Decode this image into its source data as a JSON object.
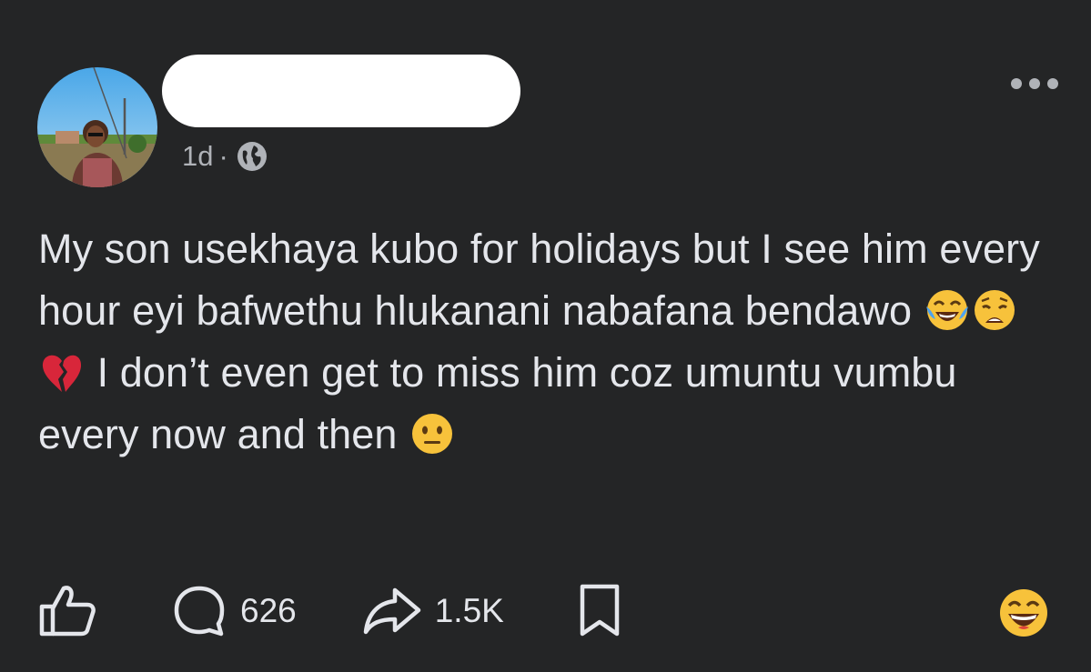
{
  "post": {
    "time": "1d",
    "separator": "·",
    "privacy_icon": "globe-icon",
    "more_icon": "more-horizontal-icon",
    "text_segments": [
      "My son usekhaya kubo for holidays but I see him every hour eyi bafwethu hlukanani nabafana bendawo ",
      " I don’t even get to miss him coz umuntu vumbu every now and then "
    ],
    "emojis": [
      "face-with-tears-of-joy",
      "weary-face",
      "broken-heart",
      "neutral-face"
    ]
  },
  "actions": {
    "like_icon": "thumbs-up-icon",
    "comment_icon": "comment-bubble-icon",
    "comment_count": "626",
    "share_icon": "share-arrow-icon",
    "share_count": "1.5K",
    "save_icon": "bookmark-icon",
    "reaction_icon": "grinning-sweat-face"
  },
  "colors": {
    "background": "#242526",
    "text": "#e4e6eb",
    "secondary_text": "#b0b3b8"
  }
}
